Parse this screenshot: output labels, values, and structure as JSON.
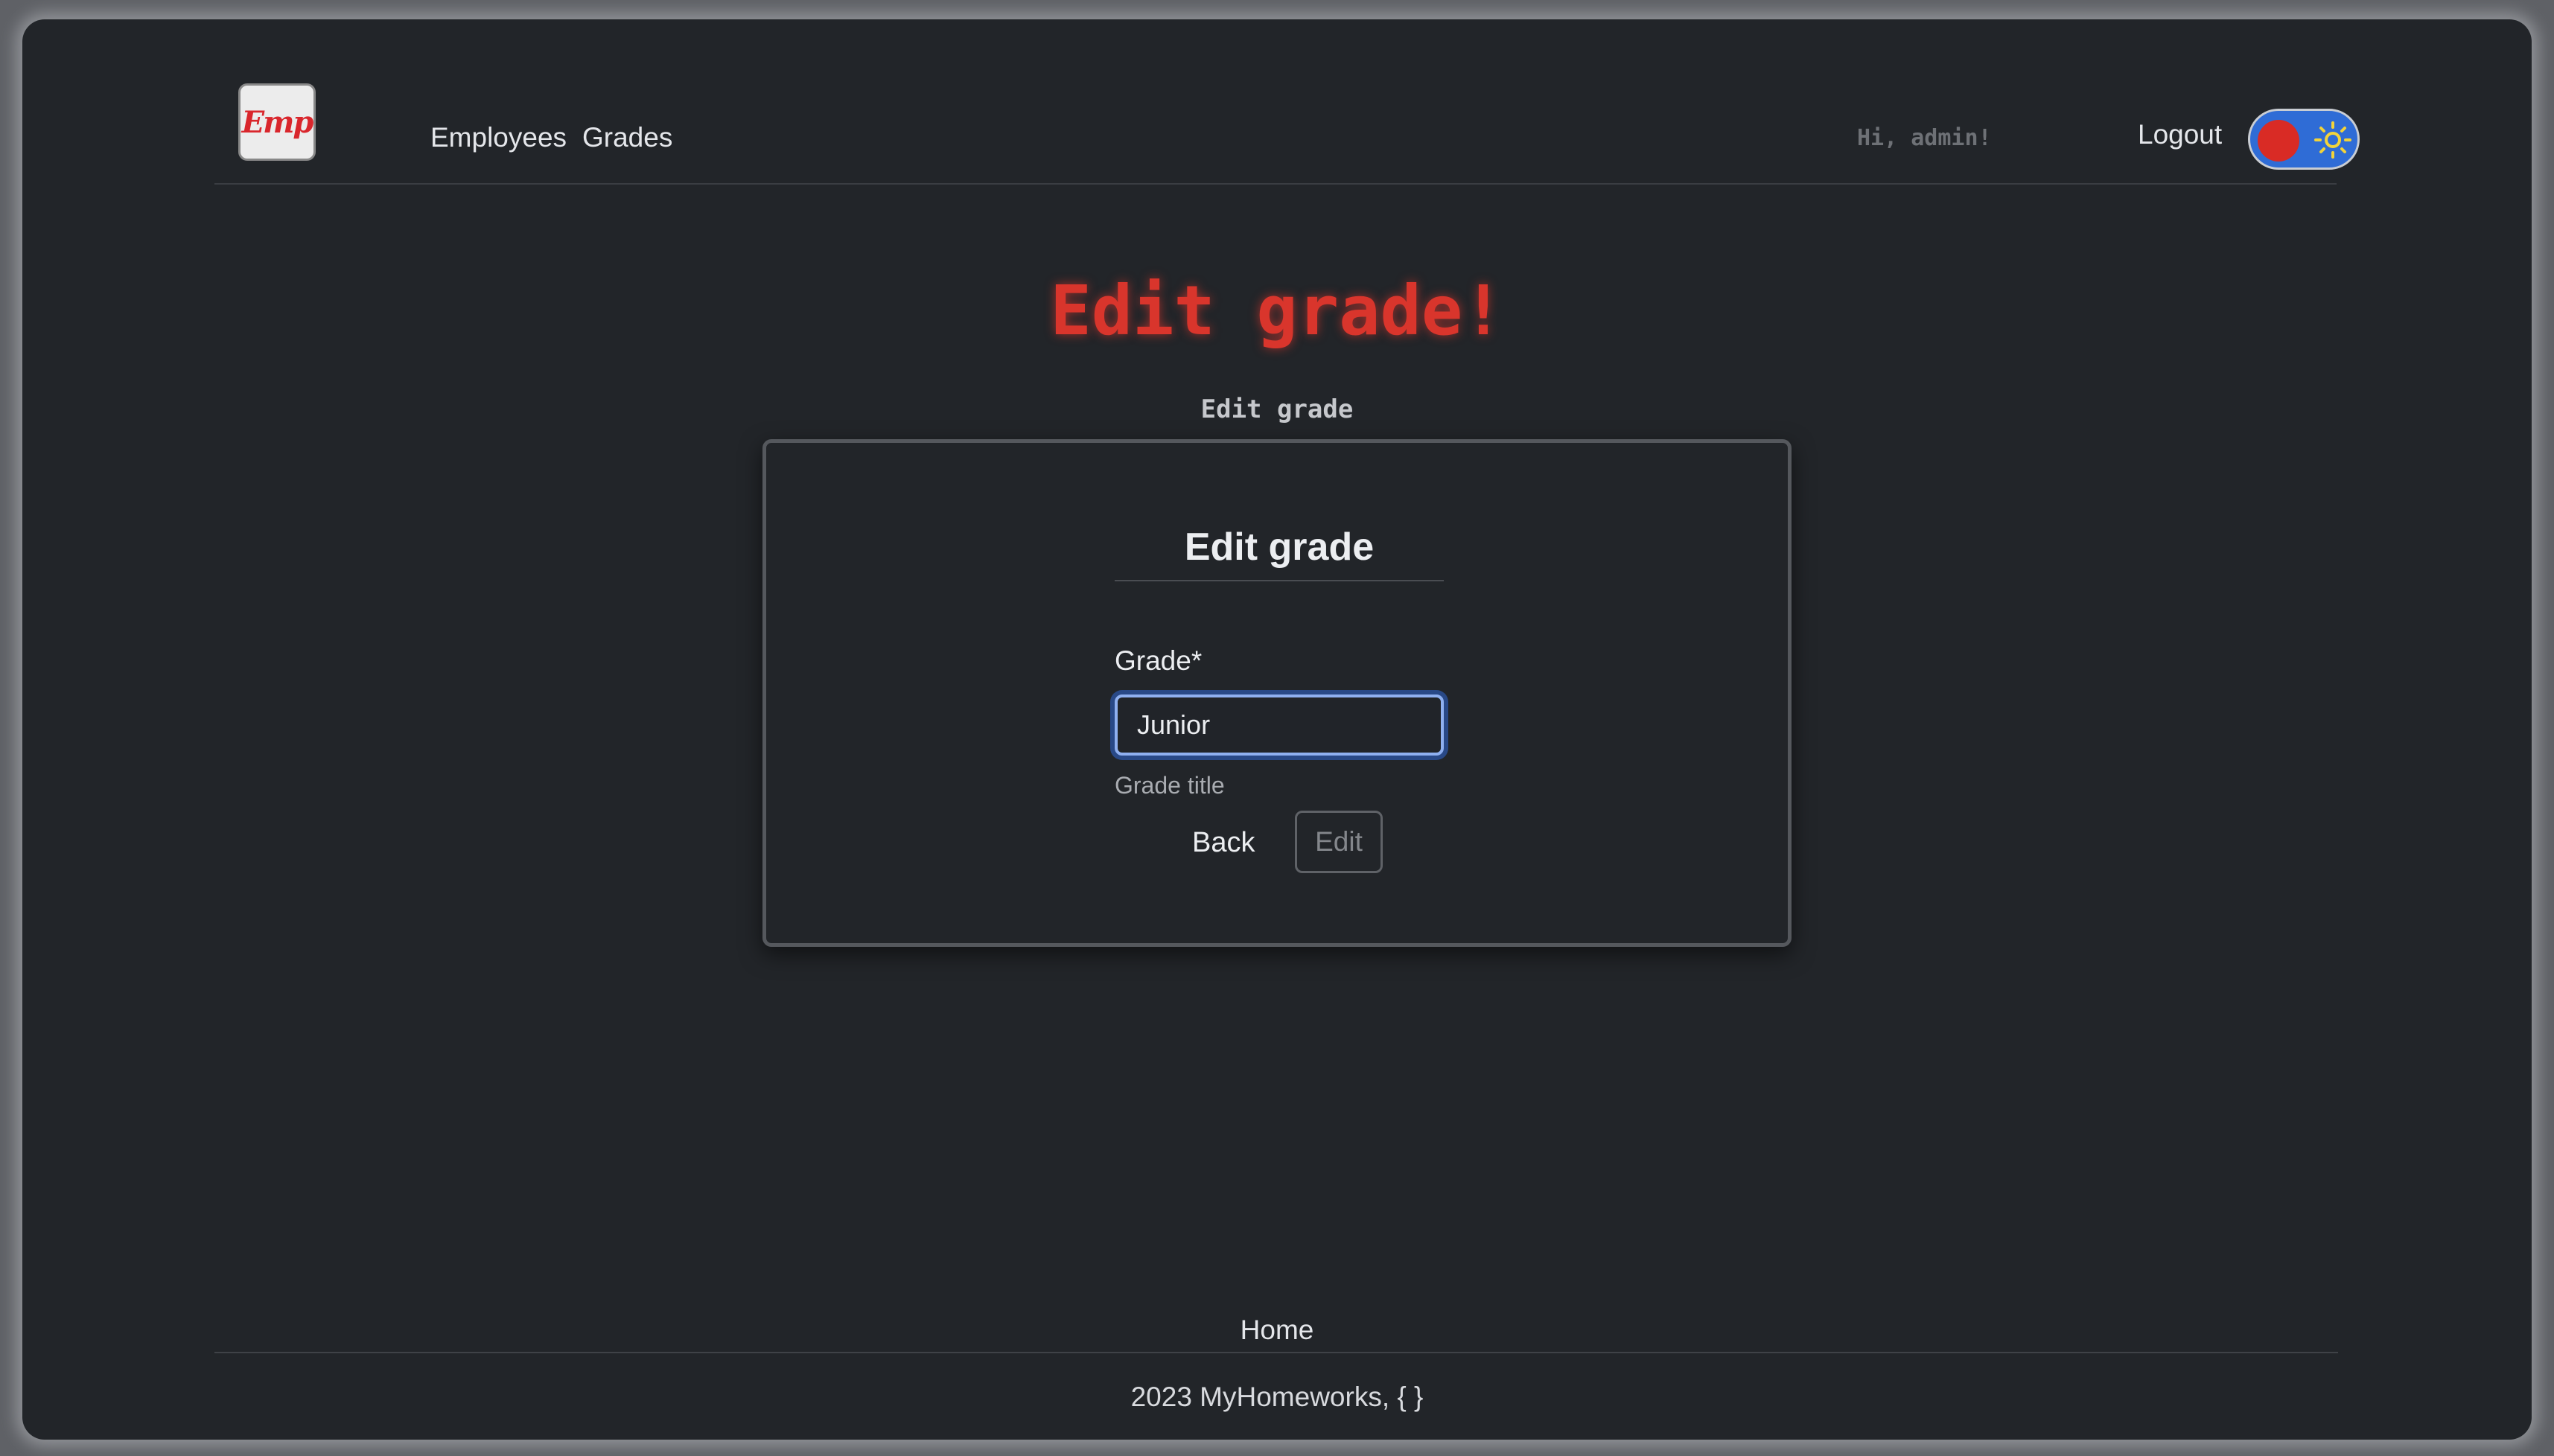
{
  "header": {
    "logo_text": "Emp",
    "nav": {
      "employees": "Employees",
      "grades": "Grades"
    },
    "greeting": "Hi, admin!",
    "logout": "Logout",
    "theme_toggle": {
      "state": "light-mode-option",
      "knob_color": "#d92b25",
      "track_color": "#2f6cd6",
      "icon": "sun-icon"
    }
  },
  "hero": {
    "title": "Edit grade!",
    "subtitle": "Edit grade"
  },
  "form": {
    "title": "Edit grade",
    "field_label": "Grade*",
    "field_value": "Junior",
    "help_text": "Grade title",
    "back_label": "Back",
    "submit_label": "Edit"
  },
  "footer": {
    "home_link": "Home",
    "copyright": "2023 MyHomeworks, { }"
  },
  "colors": {
    "background": "#222529",
    "accent_red": "#d9352c",
    "focus_blue": "#3068d6"
  }
}
